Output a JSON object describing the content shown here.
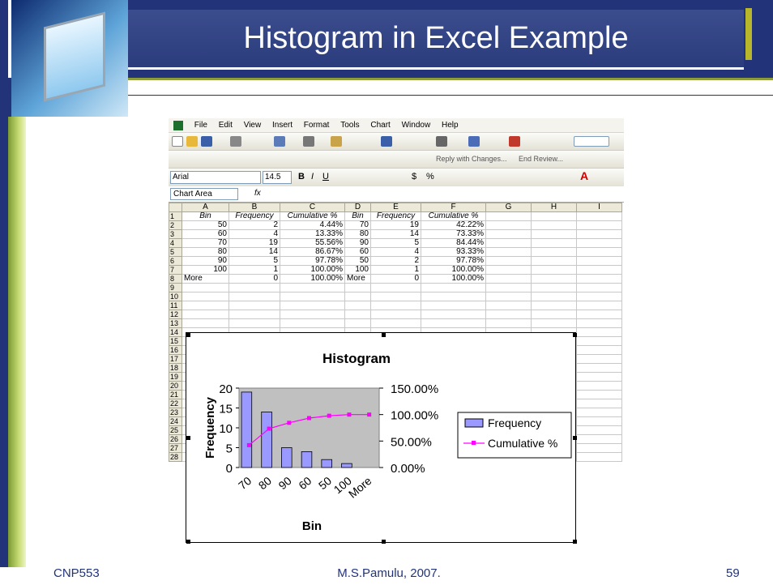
{
  "slide": {
    "title": "Histogram in Excel Example",
    "footer_left": "CNP553",
    "footer_center": "M.S.Pamulu, 2007.",
    "footer_right": "59"
  },
  "excel": {
    "menu": [
      "File",
      "Edit",
      "View",
      "Insert",
      "Format",
      "Tools",
      "Chart",
      "Window",
      "Help"
    ],
    "reviewing": {
      "reply": "Reply with Changes...",
      "end": "End Review..."
    },
    "font": "Arial",
    "size": "14.5",
    "name_box": "Chart Area",
    "fx": "fx",
    "columns": [
      "A",
      "B",
      "C",
      "D",
      "E",
      "F",
      "G",
      "H",
      "I"
    ],
    "rows": [
      [
        "Bin",
        "Frequency",
        "Cumulative %",
        "Bin",
        "Frequency",
        "Cumulative %"
      ],
      [
        "50",
        "2",
        "4.44%",
        "70",
        "19",
        "42.22%"
      ],
      [
        "60",
        "4",
        "13.33%",
        "80",
        "14",
        "73.33%"
      ],
      [
        "70",
        "19",
        "55.56%",
        "90",
        "5",
        "84.44%"
      ],
      [
        "80",
        "14",
        "86.67%",
        "60",
        "4",
        "93.33%"
      ],
      [
        "90",
        "5",
        "97.78%",
        "50",
        "2",
        "97.78%"
      ],
      [
        "100",
        "1",
        "100.00%",
        "100",
        "1",
        "100.00%"
      ],
      [
        "More",
        "0",
        "100.00%",
        "More",
        "0",
        "100.00%"
      ]
    ],
    "row_count": 28
  },
  "chart_data": {
    "type": "bar",
    "title": "Histogram",
    "xlabel": "Bin",
    "ylabel": "Frequency",
    "categories": [
      "70",
      "80",
      "90",
      "60",
      "50",
      "100",
      "More"
    ],
    "series": [
      {
        "name": "Frequency",
        "type": "bar",
        "values": [
          19,
          14,
          5,
          4,
          2,
          1,
          0
        ],
        "color": "#9999ff"
      },
      {
        "name": "Cumulative %",
        "type": "line",
        "axis": "right",
        "values": [
          42.22,
          73.33,
          84.44,
          93.33,
          97.78,
          100,
          100
        ],
        "color": "#ff00ff"
      }
    ],
    "ylim": [
      0,
      20
    ],
    "yticks": [
      "0",
      "5",
      "10",
      "15",
      "20"
    ],
    "y2lim": [
      0,
      150
    ],
    "y2ticks": [
      "0.00%",
      "50.00%",
      "100.00%",
      "150.00%"
    ],
    "legend": "right",
    "plot_bg": "#c0c0c0"
  }
}
